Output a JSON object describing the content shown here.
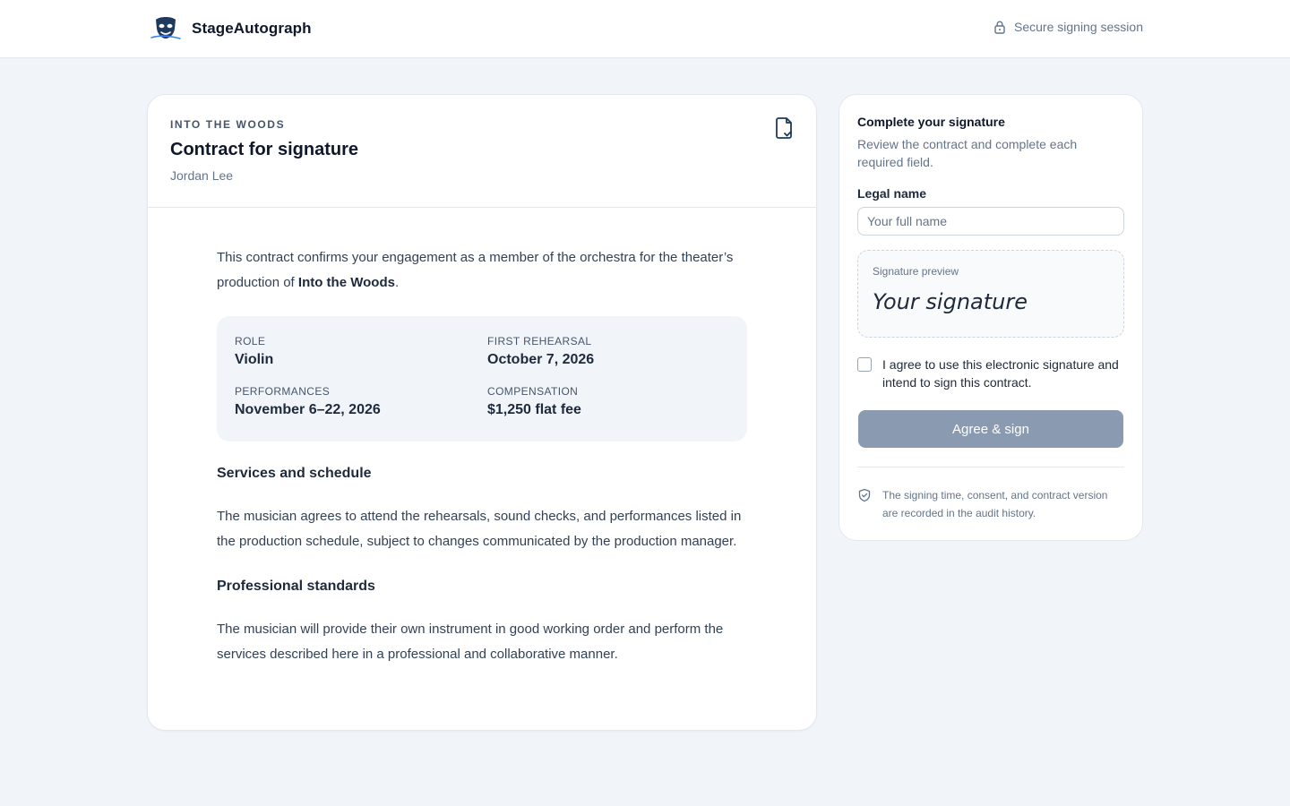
{
  "header": {
    "brand_name": "StageAutograph",
    "logo_icon": "mask-logo-icon",
    "secure_label": "Secure signing session",
    "secure_icon": "lock-icon"
  },
  "contract": {
    "eyebrow": "INTO THE WOODS",
    "title": "Contract for signature",
    "signer": "Jordan Lee",
    "doc_icon": "document-check-icon",
    "intro_before": "This contract confirms your engagement as a member of the orchestra for the theater’s production of ",
    "intro_strong": "Into the Woods",
    "intro_after": ".",
    "details": [
      {
        "label": "ROLE",
        "value": "Violin"
      },
      {
        "label": "FIRST REHEARSAL",
        "value": "October 7, 2026"
      },
      {
        "label": "PERFORMANCES",
        "value": "November 6–22, 2026"
      },
      {
        "label": "COMPENSATION",
        "value": "$1,250 flat fee"
      }
    ],
    "sections": [
      {
        "heading": "Services and schedule",
        "body": "The musician agrees to attend the rehearsals, sound checks, and performances listed in the production schedule, subject to changes communicated by the production manager."
      },
      {
        "heading": "Professional standards",
        "body": "The musician will provide their own instrument in good working order and perform the services described here in a professional and collaborative manner."
      }
    ]
  },
  "signing": {
    "title": "Complete your signature",
    "description": "Review the contract and complete each required field.",
    "legal_name_label": "Legal name",
    "legal_name_placeholder": "Your full name",
    "legal_name_value": "",
    "preview_label": "Signature preview",
    "preview_placeholder": "Your signature",
    "agree_text": "I agree to use this electronic signature and intend to sign this contract.",
    "agree_checked": false,
    "submit_label": "Agree & sign",
    "submit_disabled": true,
    "audit_icon": "shield-check-icon",
    "audit_text": "The signing time, consent, and contract version are recorded in the audit history."
  },
  "colors": {
    "page_bg": "#f1f5f9",
    "brand_navy": "#1e3a5f",
    "disabled_button": "#8a9ab0"
  }
}
